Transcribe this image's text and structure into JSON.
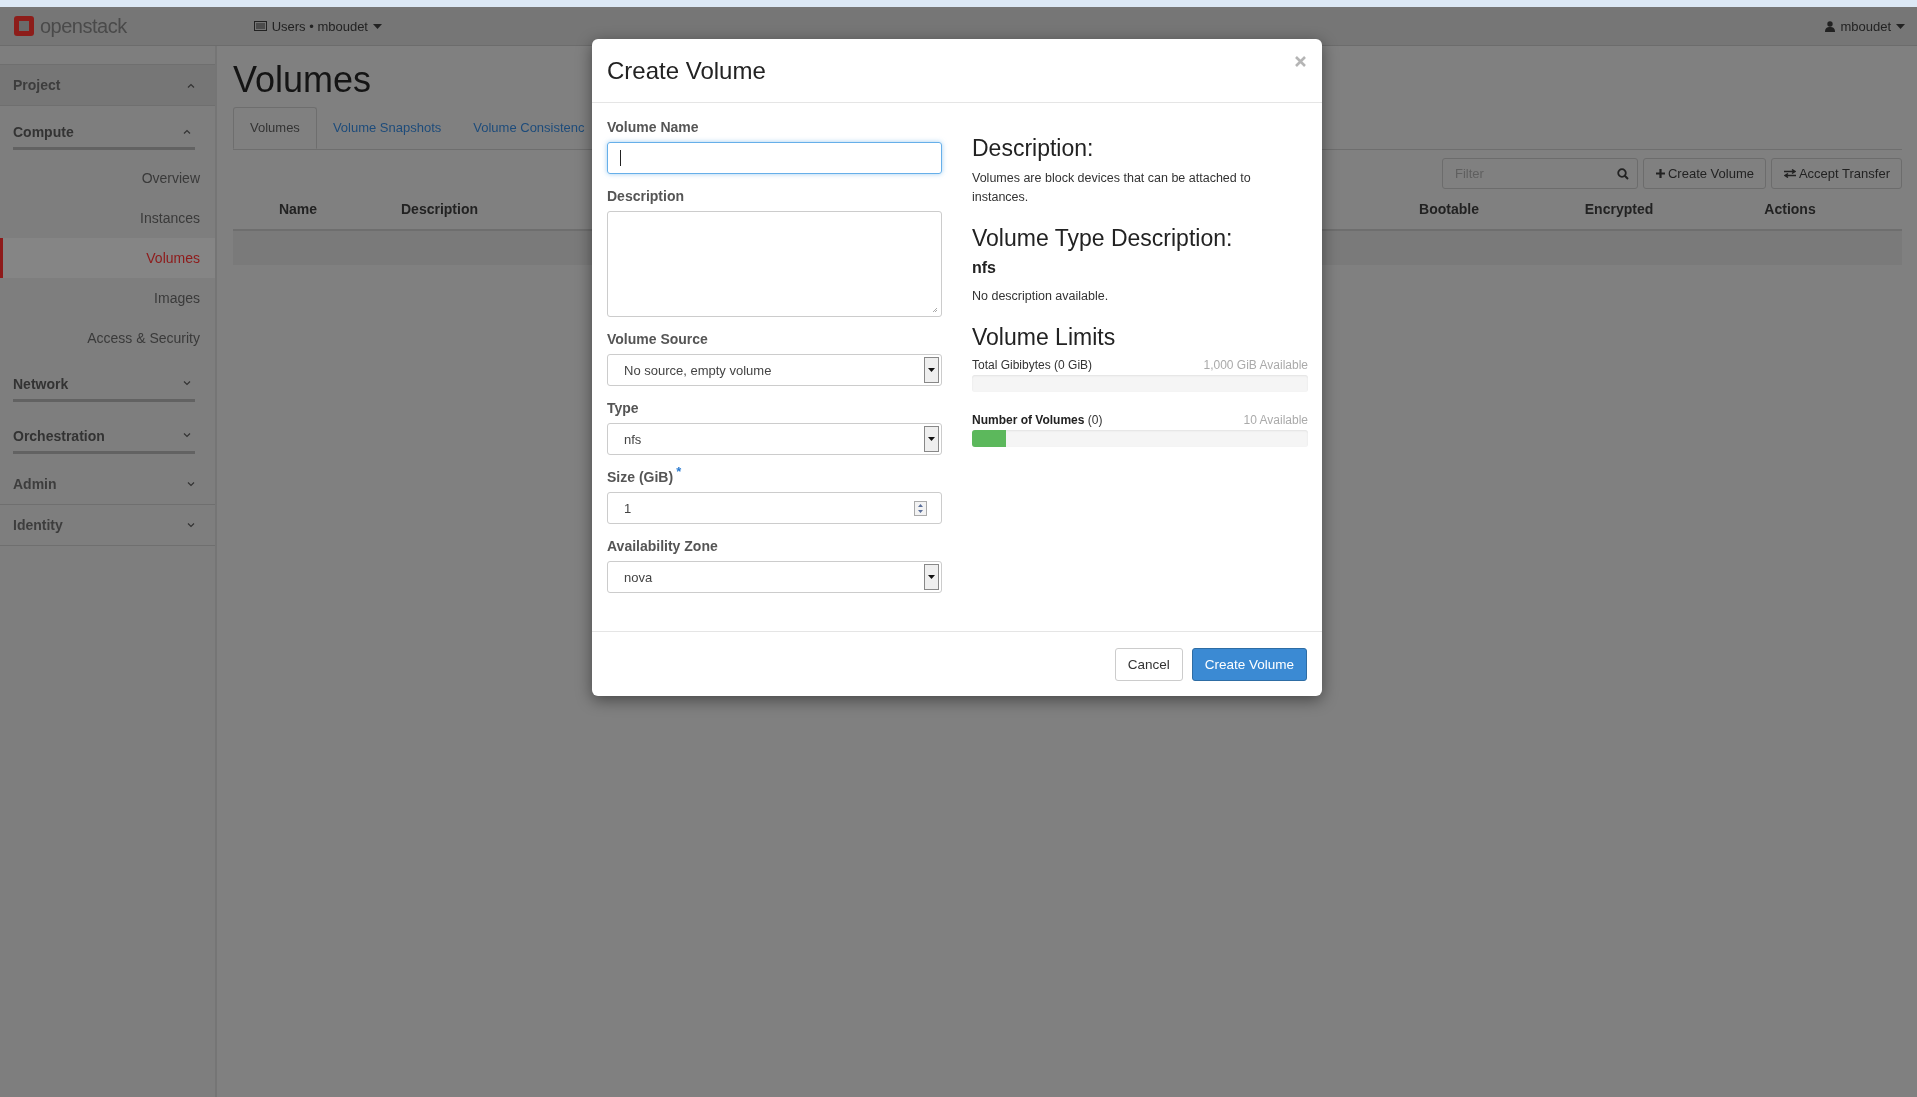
{
  "header": {
    "logo": "openstack",
    "project_menu": "Users • mboudet",
    "user_menu": "mboudet"
  },
  "sidebar": [
    {
      "label": "Project",
      "expanded": true,
      "children": [
        {
          "label": "Compute",
          "expanded": true,
          "children": [
            {
              "label": "Overview",
              "selected": false
            },
            {
              "label": "Instances",
              "selected": false
            },
            {
              "label": "Volumes",
              "selected": true
            },
            {
              "label": "Images",
              "selected": false
            },
            {
              "label": "Access & Security",
              "selected": false
            }
          ]
        },
        {
          "label": "Network",
          "expanded": false
        },
        {
          "label": "Orchestration",
          "expanded": false
        }
      ]
    },
    {
      "label": "Admin",
      "expanded": false
    },
    {
      "label": "Identity",
      "expanded": false
    }
  ],
  "page": {
    "title": "Volumes",
    "tabs": [
      {
        "label": "Volumes",
        "selected": true
      },
      {
        "label": "Volume Snapshots",
        "selected": false
      },
      {
        "label": "Volume Consistenc",
        "selected": false
      }
    ],
    "filter": {
      "placeholder": "Filter"
    },
    "actions": [
      {
        "label": "Create Volume",
        "kind": "create"
      },
      {
        "label": "Accept Transfer",
        "kind": "transfer"
      }
    ],
    "table": {
      "columns": [
        "Name",
        "Description",
        "Bootable",
        "Encrypted",
        "Actions"
      ]
    }
  },
  "modal": {
    "title": "Create Volume",
    "fields": [
      {
        "label": "Volume Name",
        "kind": "text",
        "focused": true
      },
      {
        "label": "Description",
        "kind": "textarea",
        "focused": false
      },
      {
        "label": "Volume Source",
        "kind": "select",
        "value": "No source, empty volume",
        "focused": false
      },
      {
        "label": "Type",
        "kind": "select",
        "value": "nfs",
        "focused": false
      },
      {
        "label": "Size (GiB)",
        "kind": "number",
        "value": "1",
        "focused": false,
        "required_mark": "*"
      },
      {
        "label": "Availability Zone",
        "kind": "select",
        "value": "nova",
        "focused": false
      }
    ],
    "info": {
      "description_heading": "Description:",
      "description": "Volumes are block devices that can be attached to instances.",
      "type_heading": "Volume Type Description:",
      "type_name": "nfs",
      "type_description": "No description available.",
      "limits_heading": "Volume Limits",
      "limits": [
        {
          "label": "Total Gibibytes (0 GiB)",
          "available": "1,000 GiB Available",
          "level": 0
        },
        {
          "label": "**Number of Volumes** (0)",
          "available": "10 Available",
          "level": 0.1
        }
      ]
    },
    "buttons": [
      {
        "label": "Cancel",
        "kind": "secondary"
      },
      {
        "label": "Create Volume",
        "kind": "primary"
      }
    ]
  }
}
